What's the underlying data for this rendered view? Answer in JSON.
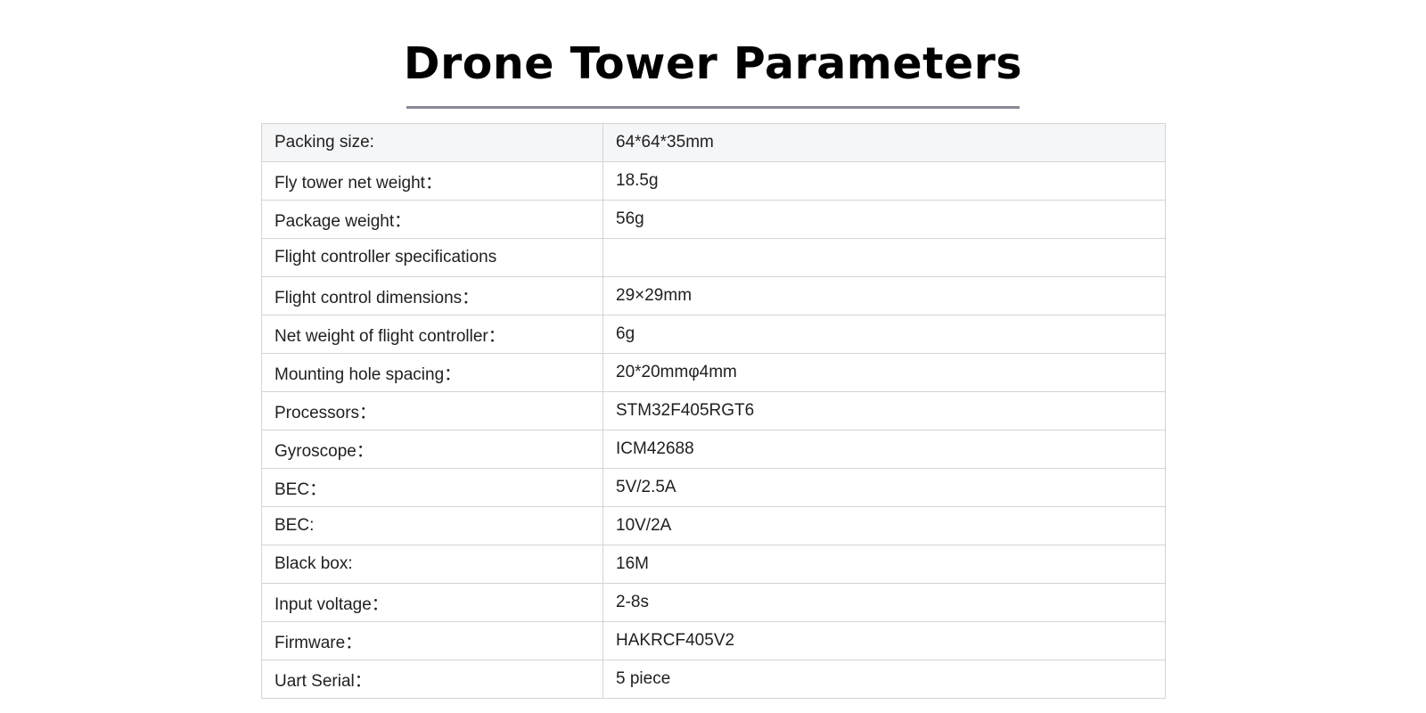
{
  "title": "Drone Tower Parameters",
  "rows": [
    {
      "label": "Packing size:",
      "value": "64*64*35mm"
    },
    {
      "label": "Fly tower net weight：",
      "value": "18.5g"
    },
    {
      "label": "Package weight：",
      "value": "56g"
    },
    {
      "label": "Flight controller specifications",
      "value": ""
    },
    {
      "label": "Flight control dimensions：",
      "value": "29×29mm"
    },
    {
      "label": "Net weight of flight controller：",
      "value": "6g"
    },
    {
      "label": "Mounting hole spacing：",
      "value": "20*20mmφ4mm"
    },
    {
      "label": "Processors：",
      "value": "STM32F405RGT6"
    },
    {
      "label": "Gyroscope：",
      "value": "ICM42688"
    },
    {
      "label": "BEC：",
      "value": "5V/2.5A"
    },
    {
      "label": "BEC:",
      "value": "10V/2A"
    },
    {
      "label": "Black box:",
      "value": "16M"
    },
    {
      "label": "Input voltage：",
      "value": "2-8s"
    },
    {
      "label": "Firmware：",
      "value": "HAKRCF405V2"
    },
    {
      "label": "Uart Serial：",
      "value": "5 piece"
    }
  ]
}
